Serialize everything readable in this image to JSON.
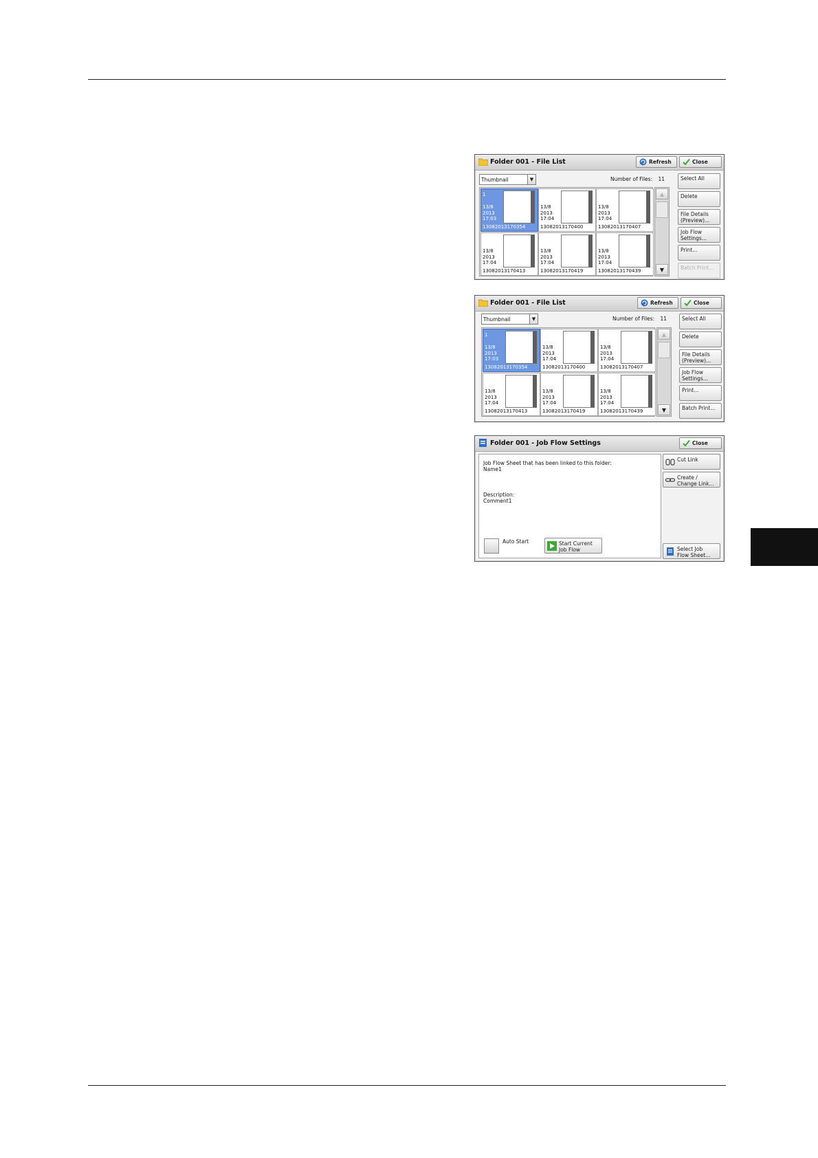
{
  "panel1": {
    "title": "Folder 001 - File List",
    "refresh_label": "Refresh",
    "close_label": "Close",
    "view_select": "Thumbnail",
    "count_label": "Number of Files:",
    "count_value": "11",
    "files": [
      {
        "num": "1",
        "date": "13/8\n2013\n17:03",
        "name": "13082013170354",
        "selected": true
      },
      {
        "num": "",
        "date": "13/8\n2013\n17:04",
        "name": "13082013170400",
        "selected": false
      },
      {
        "num": "",
        "date": "13/8\n2013\n17:04",
        "name": "13082013170407",
        "selected": false
      },
      {
        "num": "",
        "date": "13/8\n2013\n17:04",
        "name": "13082013170413",
        "selected": false
      },
      {
        "num": "",
        "date": "13/8\n2013\n17:04",
        "name": "13082013170419",
        "selected": false
      },
      {
        "num": "",
        "date": "13/8\n2013\n17:04",
        "name": "13082013170439",
        "selected": false
      }
    ],
    "side_buttons": [
      "Select All",
      "Delete",
      "File Details (Preview)...",
      "Job Flow Settings...",
      "Print...",
      "Batch Print..."
    ],
    "batch_enabled": false
  },
  "panel2": {
    "title": "Folder 001 - File List",
    "refresh_label": "Refresh",
    "close_label": "Close",
    "view_select": "Thumbnail",
    "count_label": "Number of Files:",
    "count_value": "11",
    "files": [
      {
        "num": "1",
        "date": "13/8\n2013\n17:03",
        "name": "13082013170354",
        "selected": true
      },
      {
        "num": "",
        "date": "13/8\n2013\n17:04",
        "name": "13082013170400",
        "selected": false
      },
      {
        "num": "",
        "date": "13/8\n2013\n17:04",
        "name": "13082013170407",
        "selected": false
      },
      {
        "num": "",
        "date": "13/8\n2013\n17:04",
        "name": "13082013170413",
        "selected": false
      },
      {
        "num": "",
        "date": "13/8\n2013\n17:04",
        "name": "13082013170419",
        "selected": false
      },
      {
        "num": "",
        "date": "13/8\n2013\n17:04",
        "name": "13082013170439",
        "selected": false
      }
    ],
    "side_buttons": [
      "Select All",
      "Delete",
      "File Details (Preview)...",
      "Job Flow Settings...",
      "Print...",
      "Batch Print..."
    ],
    "batch_enabled": true
  },
  "panel3": {
    "title": "Folder 001 - Job Flow Settings",
    "close_label": "Close",
    "linked_label": "Job Flow Sheet that has been linked to this folder:",
    "linked_value": "Name1",
    "description_label": "Description:",
    "description_value": "Comment1",
    "auto_start_label": "Auto Start",
    "start_label_1": "Start Current",
    "start_label_2": "Job Flow",
    "cut_link_label": "Cut Link",
    "create_label_1": "Create /",
    "create_label_2": "Change Link...",
    "select_label_1": "Select Job",
    "select_label_2": "Flow Sheet..."
  },
  "colors": {
    "selected_cell": "#6d97e0",
    "close_check": "#3aa832",
    "refresh_icon": "#2f6fc4",
    "start_icon": "#3aa832",
    "folder_icon": "#f2c230",
    "side_tab": "#111111"
  }
}
